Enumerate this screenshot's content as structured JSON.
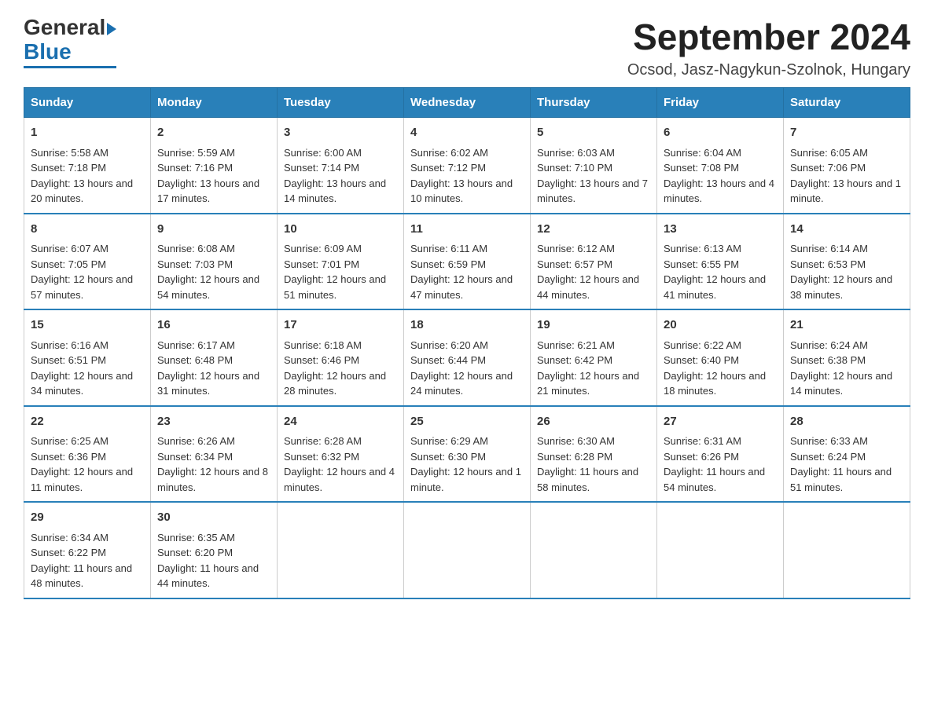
{
  "header": {
    "logo_line1": "General",
    "logo_line2": "Blue",
    "title": "September 2024",
    "subtitle": "Ocsod, Jasz-Nagykun-Szolnok, Hungary"
  },
  "weekdays": [
    "Sunday",
    "Monday",
    "Tuesday",
    "Wednesday",
    "Thursday",
    "Friday",
    "Saturday"
  ],
  "weeks": [
    [
      {
        "day": "1",
        "sunrise": "Sunrise: 5:58 AM",
        "sunset": "Sunset: 7:18 PM",
        "daylight": "Daylight: 13 hours and 20 minutes."
      },
      {
        "day": "2",
        "sunrise": "Sunrise: 5:59 AM",
        "sunset": "Sunset: 7:16 PM",
        "daylight": "Daylight: 13 hours and 17 minutes."
      },
      {
        "day": "3",
        "sunrise": "Sunrise: 6:00 AM",
        "sunset": "Sunset: 7:14 PM",
        "daylight": "Daylight: 13 hours and 14 minutes."
      },
      {
        "day": "4",
        "sunrise": "Sunrise: 6:02 AM",
        "sunset": "Sunset: 7:12 PM",
        "daylight": "Daylight: 13 hours and 10 minutes."
      },
      {
        "day": "5",
        "sunrise": "Sunrise: 6:03 AM",
        "sunset": "Sunset: 7:10 PM",
        "daylight": "Daylight: 13 hours and 7 minutes."
      },
      {
        "day": "6",
        "sunrise": "Sunrise: 6:04 AM",
        "sunset": "Sunset: 7:08 PM",
        "daylight": "Daylight: 13 hours and 4 minutes."
      },
      {
        "day": "7",
        "sunrise": "Sunrise: 6:05 AM",
        "sunset": "Sunset: 7:06 PM",
        "daylight": "Daylight: 13 hours and 1 minute."
      }
    ],
    [
      {
        "day": "8",
        "sunrise": "Sunrise: 6:07 AM",
        "sunset": "Sunset: 7:05 PM",
        "daylight": "Daylight: 12 hours and 57 minutes."
      },
      {
        "day": "9",
        "sunrise": "Sunrise: 6:08 AM",
        "sunset": "Sunset: 7:03 PM",
        "daylight": "Daylight: 12 hours and 54 minutes."
      },
      {
        "day": "10",
        "sunrise": "Sunrise: 6:09 AM",
        "sunset": "Sunset: 7:01 PM",
        "daylight": "Daylight: 12 hours and 51 minutes."
      },
      {
        "day": "11",
        "sunrise": "Sunrise: 6:11 AM",
        "sunset": "Sunset: 6:59 PM",
        "daylight": "Daylight: 12 hours and 47 minutes."
      },
      {
        "day": "12",
        "sunrise": "Sunrise: 6:12 AM",
        "sunset": "Sunset: 6:57 PM",
        "daylight": "Daylight: 12 hours and 44 minutes."
      },
      {
        "day": "13",
        "sunrise": "Sunrise: 6:13 AM",
        "sunset": "Sunset: 6:55 PM",
        "daylight": "Daylight: 12 hours and 41 minutes."
      },
      {
        "day": "14",
        "sunrise": "Sunrise: 6:14 AM",
        "sunset": "Sunset: 6:53 PM",
        "daylight": "Daylight: 12 hours and 38 minutes."
      }
    ],
    [
      {
        "day": "15",
        "sunrise": "Sunrise: 6:16 AM",
        "sunset": "Sunset: 6:51 PM",
        "daylight": "Daylight: 12 hours and 34 minutes."
      },
      {
        "day": "16",
        "sunrise": "Sunrise: 6:17 AM",
        "sunset": "Sunset: 6:48 PM",
        "daylight": "Daylight: 12 hours and 31 minutes."
      },
      {
        "day": "17",
        "sunrise": "Sunrise: 6:18 AM",
        "sunset": "Sunset: 6:46 PM",
        "daylight": "Daylight: 12 hours and 28 minutes."
      },
      {
        "day": "18",
        "sunrise": "Sunrise: 6:20 AM",
        "sunset": "Sunset: 6:44 PM",
        "daylight": "Daylight: 12 hours and 24 minutes."
      },
      {
        "day": "19",
        "sunrise": "Sunrise: 6:21 AM",
        "sunset": "Sunset: 6:42 PM",
        "daylight": "Daylight: 12 hours and 21 minutes."
      },
      {
        "day": "20",
        "sunrise": "Sunrise: 6:22 AM",
        "sunset": "Sunset: 6:40 PM",
        "daylight": "Daylight: 12 hours and 18 minutes."
      },
      {
        "day": "21",
        "sunrise": "Sunrise: 6:24 AM",
        "sunset": "Sunset: 6:38 PM",
        "daylight": "Daylight: 12 hours and 14 minutes."
      }
    ],
    [
      {
        "day": "22",
        "sunrise": "Sunrise: 6:25 AM",
        "sunset": "Sunset: 6:36 PM",
        "daylight": "Daylight: 12 hours and 11 minutes."
      },
      {
        "day": "23",
        "sunrise": "Sunrise: 6:26 AM",
        "sunset": "Sunset: 6:34 PM",
        "daylight": "Daylight: 12 hours and 8 minutes."
      },
      {
        "day": "24",
        "sunrise": "Sunrise: 6:28 AM",
        "sunset": "Sunset: 6:32 PM",
        "daylight": "Daylight: 12 hours and 4 minutes."
      },
      {
        "day": "25",
        "sunrise": "Sunrise: 6:29 AM",
        "sunset": "Sunset: 6:30 PM",
        "daylight": "Daylight: 12 hours and 1 minute."
      },
      {
        "day": "26",
        "sunrise": "Sunrise: 6:30 AM",
        "sunset": "Sunset: 6:28 PM",
        "daylight": "Daylight: 11 hours and 58 minutes."
      },
      {
        "day": "27",
        "sunrise": "Sunrise: 6:31 AM",
        "sunset": "Sunset: 6:26 PM",
        "daylight": "Daylight: 11 hours and 54 minutes."
      },
      {
        "day": "28",
        "sunrise": "Sunrise: 6:33 AM",
        "sunset": "Sunset: 6:24 PM",
        "daylight": "Daylight: 11 hours and 51 minutes."
      }
    ],
    [
      {
        "day": "29",
        "sunrise": "Sunrise: 6:34 AM",
        "sunset": "Sunset: 6:22 PM",
        "daylight": "Daylight: 11 hours and 48 minutes."
      },
      {
        "day": "30",
        "sunrise": "Sunrise: 6:35 AM",
        "sunset": "Sunset: 6:20 PM",
        "daylight": "Daylight: 11 hours and 44 minutes."
      },
      null,
      null,
      null,
      null,
      null
    ]
  ]
}
